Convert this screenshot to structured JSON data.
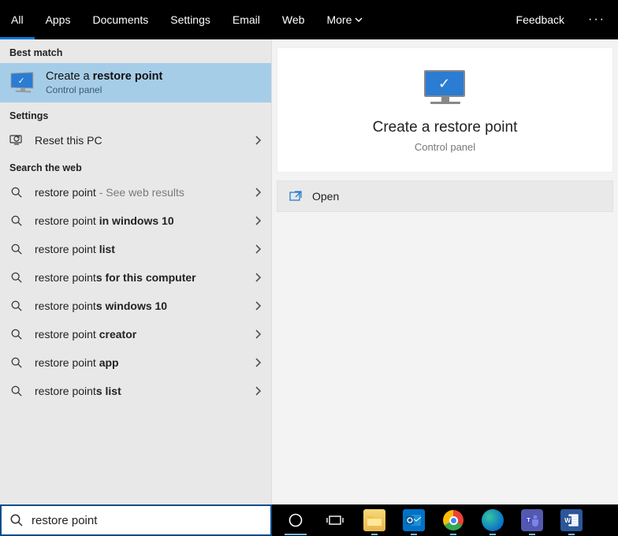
{
  "tabs": {
    "all": "All",
    "apps": "Apps",
    "documents": "Documents",
    "settings": "Settings",
    "email": "Email",
    "web": "Web",
    "more": "More",
    "feedback": "Feedback"
  },
  "sections": {
    "best_match": "Best match",
    "settings": "Settings",
    "search_web": "Search the web"
  },
  "best_match": {
    "title_pre": "Create a ",
    "title_bold": "restore point",
    "subtitle": "Control panel"
  },
  "settings_items": [
    {
      "label": "Reset this PC"
    }
  ],
  "web_items": [
    {
      "pre": "restore point",
      "bold": "",
      "trail": " - See web results",
      "trail_gray": true
    },
    {
      "pre": "restore point ",
      "bold": "in windows 10",
      "trail": ""
    },
    {
      "pre": "restore point ",
      "bold": "list",
      "trail": ""
    },
    {
      "pre": "restore point",
      "bold": "s for this computer",
      "trail": ""
    },
    {
      "pre": "restore point",
      "bold": "s windows 10",
      "trail": ""
    },
    {
      "pre": "restore point ",
      "bold": "creator",
      "trail": ""
    },
    {
      "pre": "restore point ",
      "bold": "app",
      "trail": ""
    },
    {
      "pre": "restore point",
      "bold": "s list",
      "trail": ""
    }
  ],
  "detail": {
    "title": "Create a restore point",
    "subtitle": "Control panel",
    "open": "Open"
  },
  "search": {
    "value": "restore point"
  }
}
